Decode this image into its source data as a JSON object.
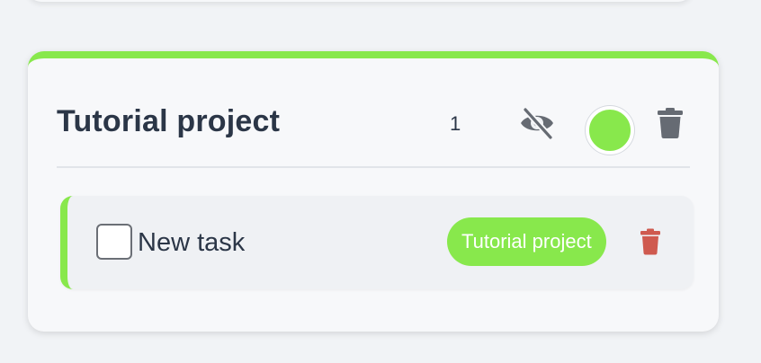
{
  "project": {
    "title": "Tutorial project",
    "task_count": "1",
    "color": "#88e84c",
    "icons": {
      "visibility": "eye-slash-icon",
      "delete": "trash-icon"
    }
  },
  "tasks": [
    {
      "name": "New task",
      "checked": false,
      "tag_label": "Tutorial project",
      "tag_color": "#88e84c",
      "delete_icon_color": "#cf5a4f"
    }
  ]
}
